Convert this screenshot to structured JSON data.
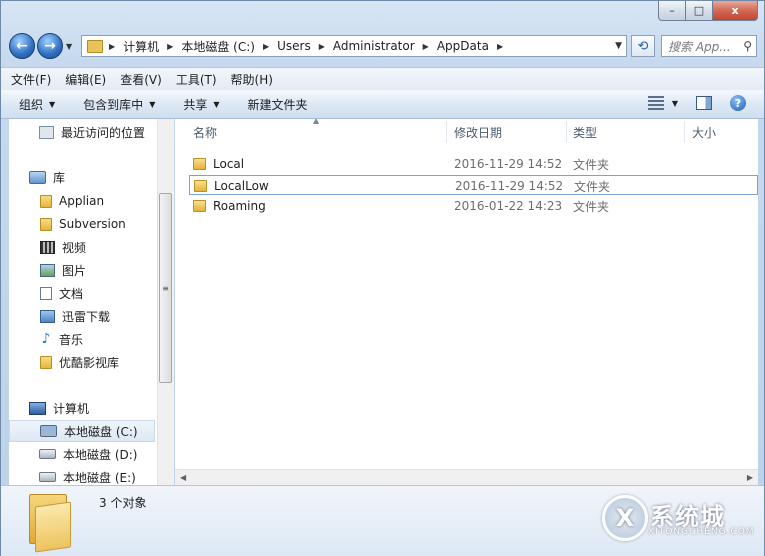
{
  "window": {
    "caption_buttons": {
      "minimize": "–",
      "maximize": "□",
      "close": "x"
    }
  },
  "nav": {
    "back_glyph": "←",
    "forward_glyph": "→",
    "breadcrumbs": [
      "计算机",
      "本地磁盘 (C:)",
      "Users",
      "Administrator",
      "AppData"
    ],
    "refresh_glyph": "⟲",
    "search_placeholder": "搜索 App...",
    "search_glyph": "⚲"
  },
  "menu": [
    "文件(F)",
    "编辑(E)",
    "查看(V)",
    "工具(T)",
    "帮助(H)"
  ],
  "commands": {
    "organize": "组织",
    "include_in_library": "包含到库中",
    "share": "共享",
    "new_folder": "新建文件夹",
    "help_glyph": "?"
  },
  "navpane": {
    "recent": "最近访问的位置",
    "library": "库",
    "library_items": [
      {
        "label": "Applian",
        "icon": "folder-icon"
      },
      {
        "label": "Subversion",
        "icon": "folder-icon"
      },
      {
        "label": "视频",
        "icon": "video-icon"
      },
      {
        "label": "图片",
        "icon": "picture-icon"
      },
      {
        "label": "文档",
        "icon": "document-icon"
      },
      {
        "label": "迅雷下载",
        "icon": "download-icon"
      },
      {
        "label": "音乐",
        "icon": "music-icon"
      },
      {
        "label": "优酷影视库",
        "icon": "folder-icon"
      }
    ],
    "computer": "计算机",
    "drives": [
      {
        "label": "本地磁盘 (C:)",
        "selected": true
      },
      {
        "label": "本地磁盘 (D:)",
        "selected": false
      },
      {
        "label": "本地磁盘 (E:)",
        "selected": false
      }
    ],
    "scroll_grip": "≡"
  },
  "columns": {
    "name": "名称",
    "date": "修改日期",
    "type": "类型",
    "size": "大小"
  },
  "files": [
    {
      "name": "Local",
      "date": "2016-11-29 14:52",
      "type": "文件夹"
    },
    {
      "name": "LocalLow",
      "date": "2016-11-29 14:52",
      "type": "文件夹"
    },
    {
      "name": "Roaming",
      "date": "2016-01-22 14:23",
      "type": "文件夹"
    }
  ],
  "details": {
    "object_count": "3 个对象"
  },
  "watermark": {
    "logo_letter": "X",
    "name": "系统城",
    "site": "XITONGCHENG.COM"
  }
}
